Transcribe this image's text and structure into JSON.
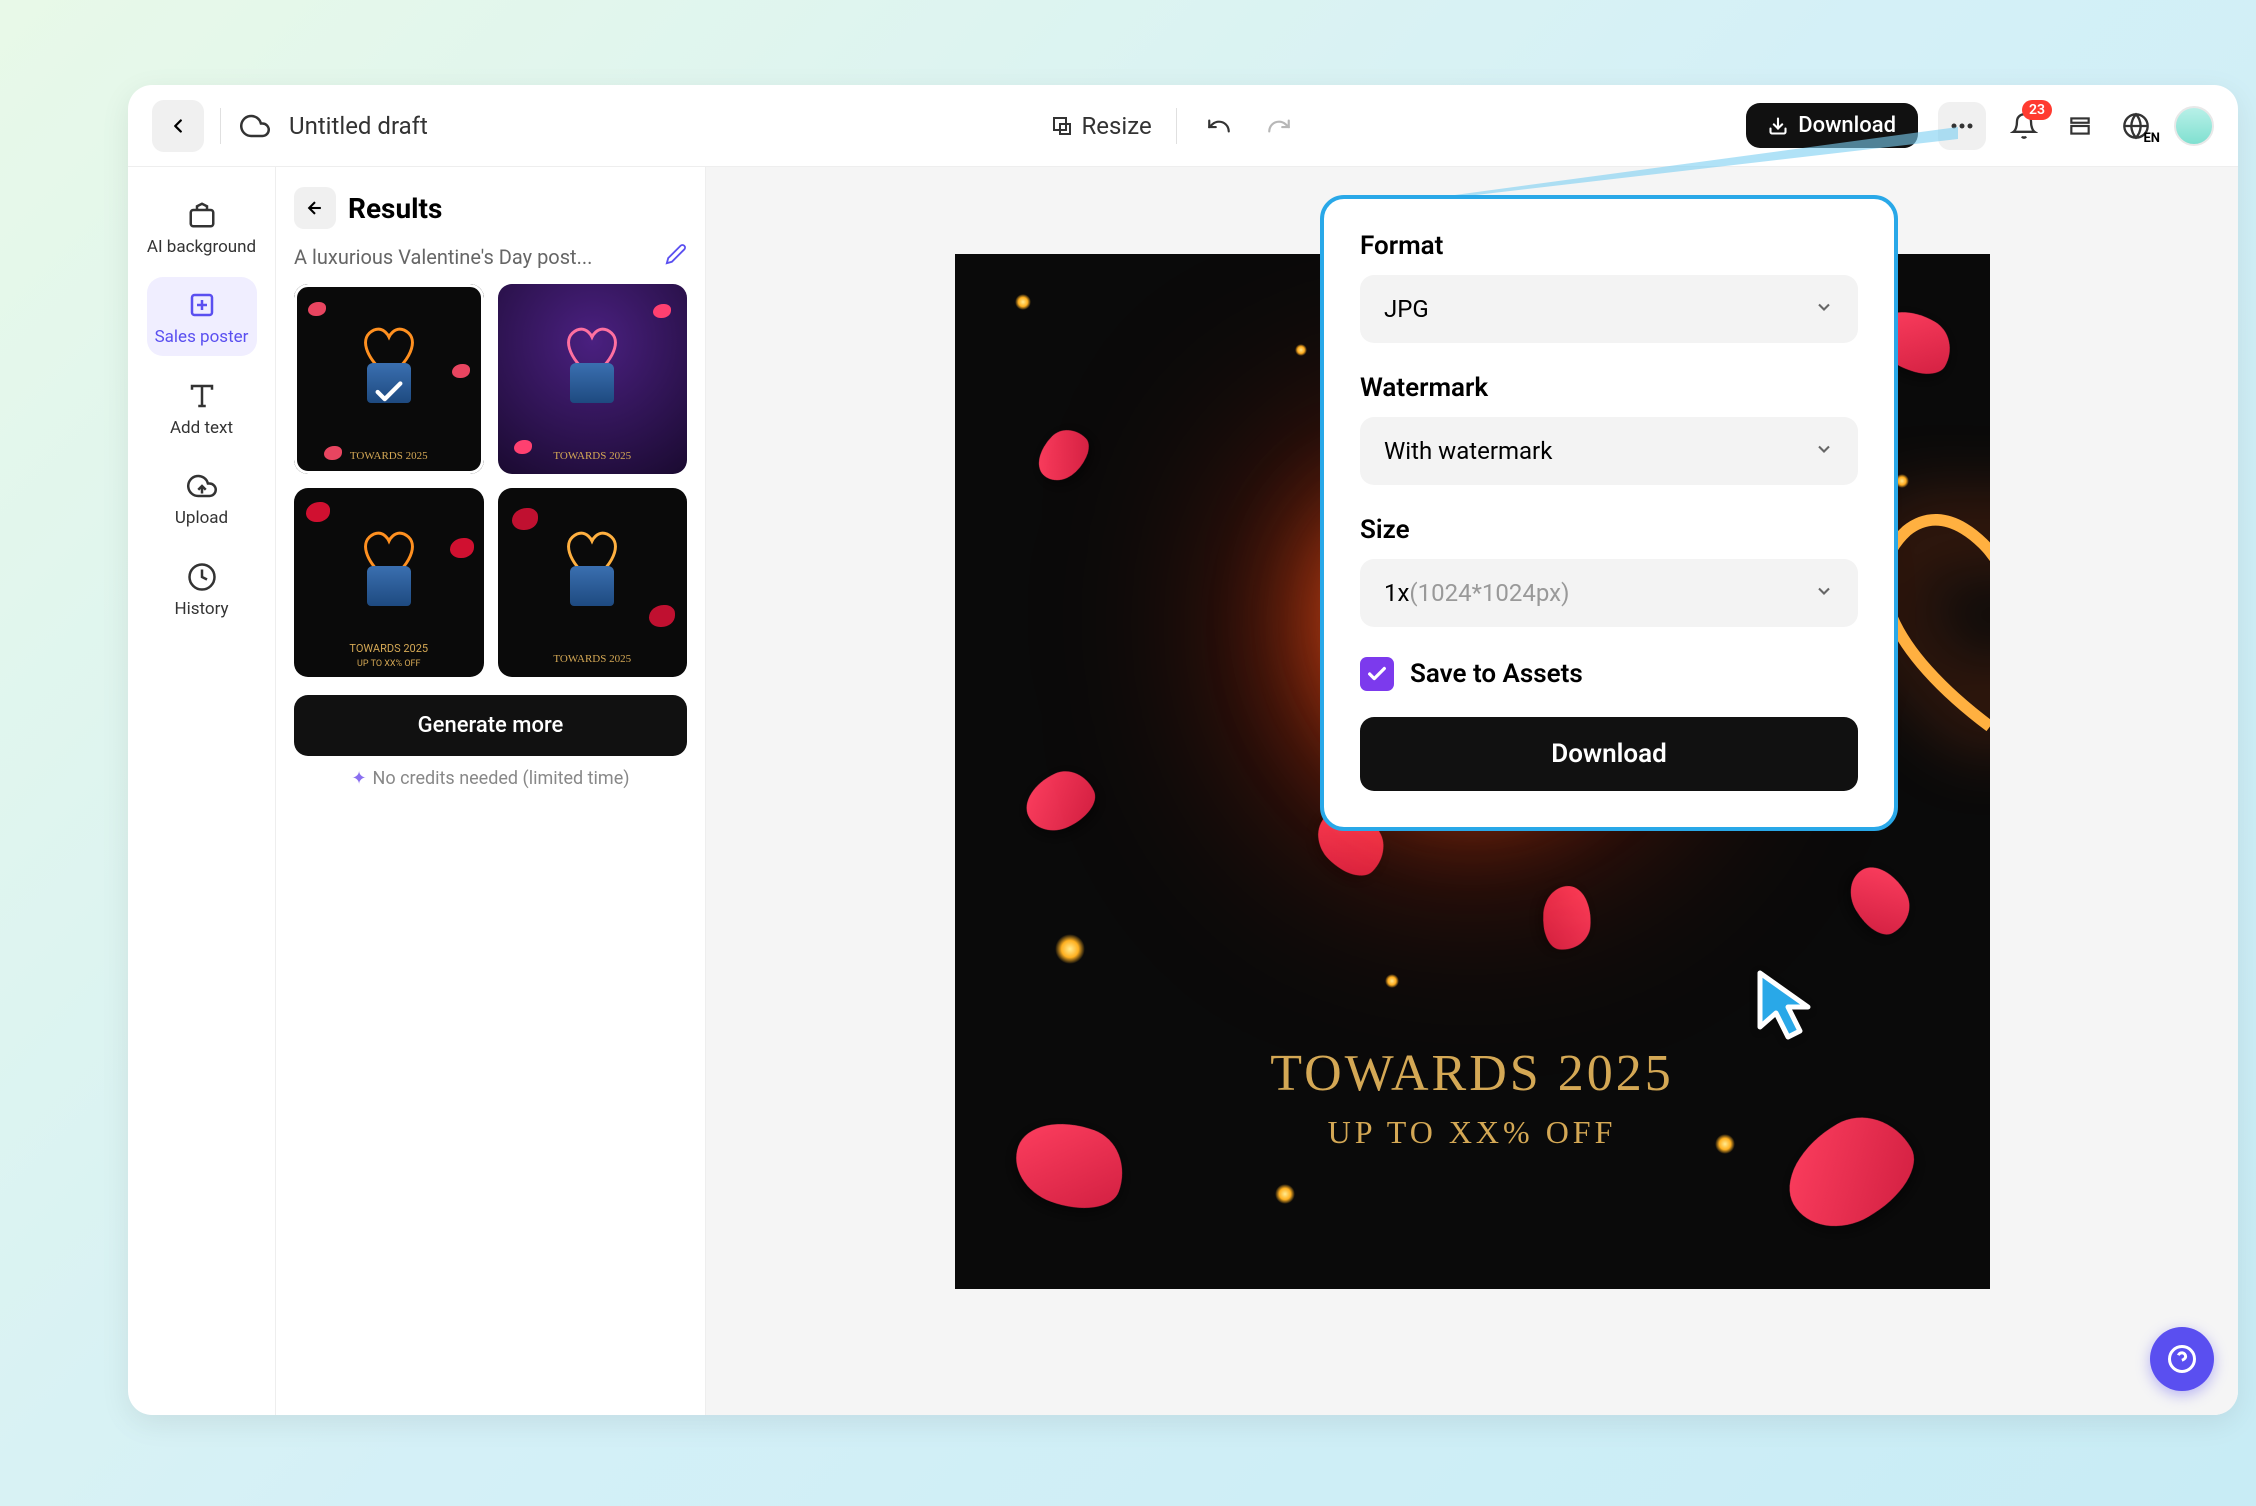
{
  "topbar": {
    "title": "Untitled draft",
    "resize": "Resize",
    "download": "Download",
    "badge": "23",
    "lang_sub": "EN"
  },
  "rail": {
    "items": [
      {
        "label": "AI background"
      },
      {
        "label": "Sales poster"
      },
      {
        "label": "Add text"
      },
      {
        "label": "Upload"
      },
      {
        "label": "History"
      }
    ]
  },
  "panel": {
    "title": "Results",
    "prompt": "A luxurious Valentine's Day post...",
    "generate": "Generate more",
    "credits": "No credits needed (limited time)",
    "thumb_title": "TOWARDS 2025",
    "thumb_sub": "UP TO XX% OFF"
  },
  "canvas": {
    "title": "TOWARDS 2025",
    "subtitle": "UP TO XX% OFF"
  },
  "popup": {
    "format_label": "Format",
    "format_value": "JPG",
    "watermark_label": "Watermark",
    "watermark_value": "With watermark",
    "size_label": "Size",
    "size_value_prefix": "1x",
    "size_value_dim": "(1024*1024px)",
    "save_label": "Save to Assets",
    "download": "Download"
  }
}
